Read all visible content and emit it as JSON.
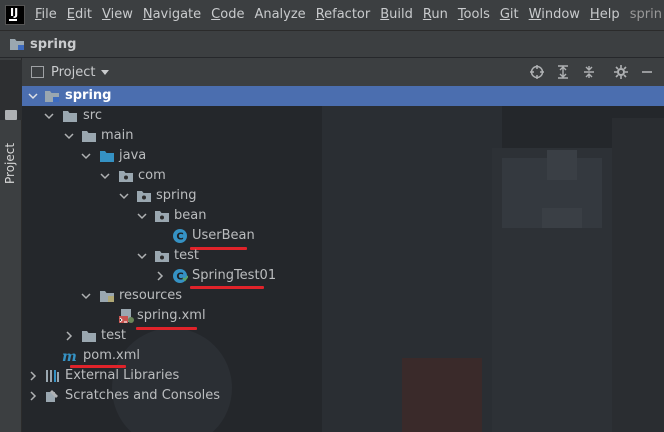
{
  "menubar": {
    "items": [
      {
        "label": "File",
        "u": "F",
        "rest": "ile"
      },
      {
        "label": "Edit",
        "u": "E",
        "rest": "dit"
      },
      {
        "label": "View",
        "u": "V",
        "rest": "iew"
      },
      {
        "label": "Navigate",
        "u": "N",
        "rest": "avigate"
      },
      {
        "label": "Code",
        "u": "C",
        "rest": "ode"
      },
      {
        "label": "Analyze",
        "u": "",
        "rest": "Analyze"
      },
      {
        "label": "Refactor",
        "u": "R",
        "rest": "efactor"
      },
      {
        "label": "Build",
        "u": "B",
        "rest": "uild"
      },
      {
        "label": "Run",
        "u": "R",
        "rest": "un"
      },
      {
        "label": "Tools",
        "u": "T",
        "rest": "ools"
      },
      {
        "label": "Git",
        "u": "G",
        "rest": "it"
      },
      {
        "label": "Window",
        "u": "W",
        "rest": "indow"
      },
      {
        "label": "Help",
        "u": "H",
        "rest": "elp"
      }
    ],
    "project_name_right": "sprin"
  },
  "navbar": {
    "project": "spring"
  },
  "tool_strip": {
    "tab_label": "Project"
  },
  "panel": {
    "title": "Project"
  },
  "tree": {
    "root": "spring",
    "src": "src",
    "main": "main",
    "java": "java",
    "com": "com",
    "spring_pkg": "spring",
    "bean": "bean",
    "userbean": "UserBean",
    "test_pkg": "test",
    "springtest": "SpringTest01",
    "resources": "resources",
    "springxml": "spring.xml",
    "test_dir": "test",
    "pom": "pom.xml",
    "external_libraries": "External Libraries",
    "scratches": "Scratches and Consoles"
  },
  "colors": {
    "selection": "#4b6eaf",
    "highlight_underline": "#e0232a",
    "class_icon": "#3592c4"
  }
}
